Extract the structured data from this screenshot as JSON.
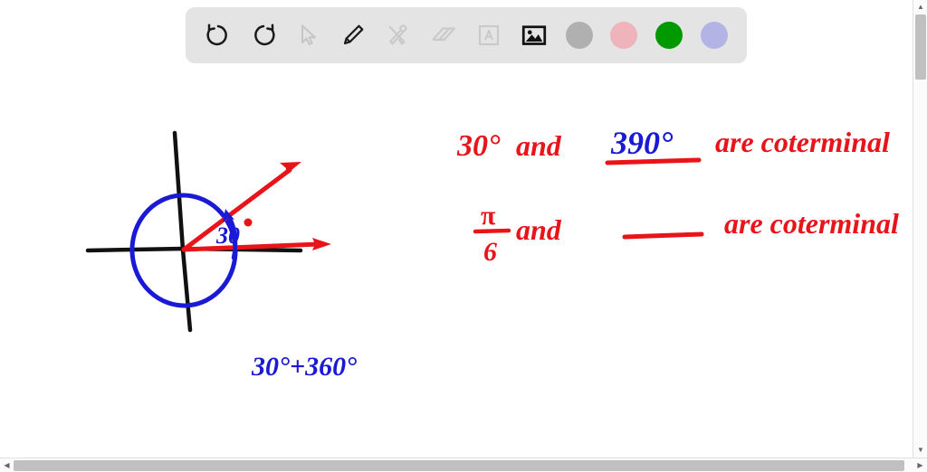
{
  "toolbar": {
    "items": [
      {
        "name": "undo-icon",
        "label": "Undo",
        "state": "enabled"
      },
      {
        "name": "redo-icon",
        "label": "Redo",
        "state": "enabled"
      },
      {
        "name": "cursor-icon",
        "label": "Select",
        "state": "disabled"
      },
      {
        "name": "pen-icon",
        "label": "Pen",
        "state": "enabled"
      },
      {
        "name": "shapes-icon",
        "label": "Shapes",
        "state": "disabled"
      },
      {
        "name": "eraser-icon",
        "label": "Eraser",
        "state": "disabled"
      },
      {
        "name": "text-icon",
        "label": "Text",
        "state": "disabled"
      },
      {
        "name": "image-icon",
        "label": "Image",
        "state": "enabled"
      }
    ],
    "swatches": [
      {
        "name": "color-swatch-gray",
        "label": "Gray",
        "color": "#b0b0b0"
      },
      {
        "name": "color-swatch-pink",
        "label": "Pink",
        "color": "#eeb3bb"
      },
      {
        "name": "color-swatch-green",
        "label": "Green",
        "color": "#009a00"
      },
      {
        "name": "color-swatch-purple",
        "label": "Purple",
        "color": "#b3b3e6"
      }
    ]
  },
  "colors": {
    "red": "#e8141a",
    "blue": "#1a1ad6",
    "black": "#111111",
    "toolbar_bg": "#e4e4e4",
    "canvas_bg": "#ffffff"
  },
  "canvas": {
    "diagram": {
      "name": "coterminal-angle-diagram",
      "angle_label": "30",
      "angle_degree_symbol": "°",
      "description": "Unit circle with x and y axes, initial ray along positive x-axis and terminal ray at 30 degrees"
    },
    "annotations": {
      "line1": {
        "part1": "30°",
        "part2": "and",
        "blank_value": "390°",
        "part3": "are coterminal"
      },
      "line2": {
        "fraction_numerator": "π",
        "fraction_denominator": "6",
        "part2": "and",
        "blank_value": "",
        "part3": "are coterminal"
      },
      "bottom_note": "30°+360°"
    }
  },
  "scrollbars": {
    "vertical": {
      "up_arrow": "▲",
      "down_arrow": "▼"
    },
    "horizontal": {
      "left_arrow": "◀",
      "right_arrow": "▶"
    }
  }
}
